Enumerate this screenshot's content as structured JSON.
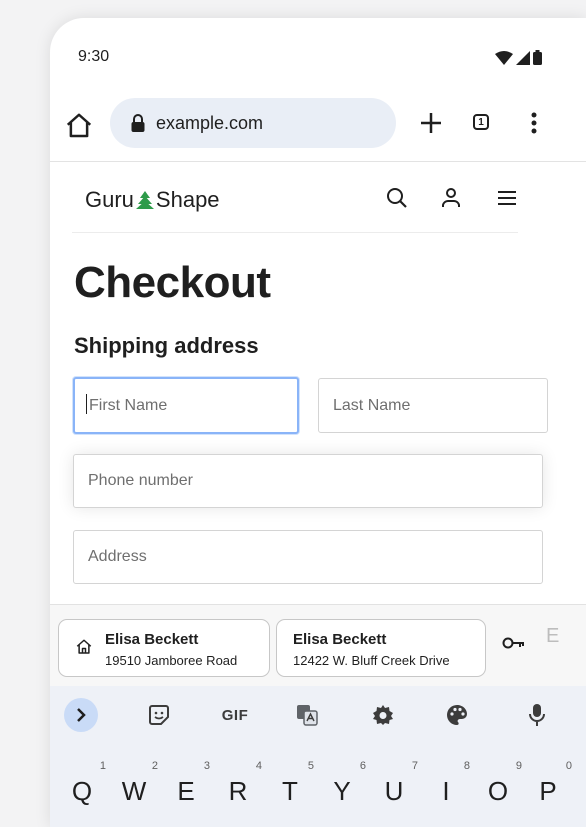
{
  "status_bar": {
    "time": "9:30"
  },
  "browser": {
    "url": "example.com",
    "tab_count": "1"
  },
  "site": {
    "logo_left": "Guru",
    "logo_right": "Shape"
  },
  "page": {
    "title": "Checkout",
    "section": "Shipping address"
  },
  "form": {
    "first_name_placeholder": "First Name",
    "last_name_placeholder": "Last Name",
    "phone_placeholder": "Phone number",
    "address_placeholder": "Address"
  },
  "autofill": {
    "suggestions": [
      {
        "name": "Elisa Beckett",
        "address": "19510 Jamboree Road"
      },
      {
        "name": "Elisa Beckett",
        "address": "12422 W. Bluff Creek Drive"
      }
    ],
    "more_hint": "E"
  },
  "keyboard": {
    "gif_label": "GIF",
    "keys": [
      {
        "letter": "Q",
        "hint": "1"
      },
      {
        "letter": "W",
        "hint": "2"
      },
      {
        "letter": "E",
        "hint": "3"
      },
      {
        "letter": "R",
        "hint": "4"
      },
      {
        "letter": "T",
        "hint": "5"
      },
      {
        "letter": "Y",
        "hint": "6"
      },
      {
        "letter": "U",
        "hint": "7"
      },
      {
        "letter": "I",
        "hint": "8"
      },
      {
        "letter": "O",
        "hint": "9"
      },
      {
        "letter": "P",
        "hint": "0"
      }
    ]
  },
  "colors": {
    "focus_border": "#8ab4f8",
    "omnibox_bg": "#e9eef6",
    "logo_green": "#2e9b4a",
    "keyboard_bg": "#eef1f7"
  }
}
